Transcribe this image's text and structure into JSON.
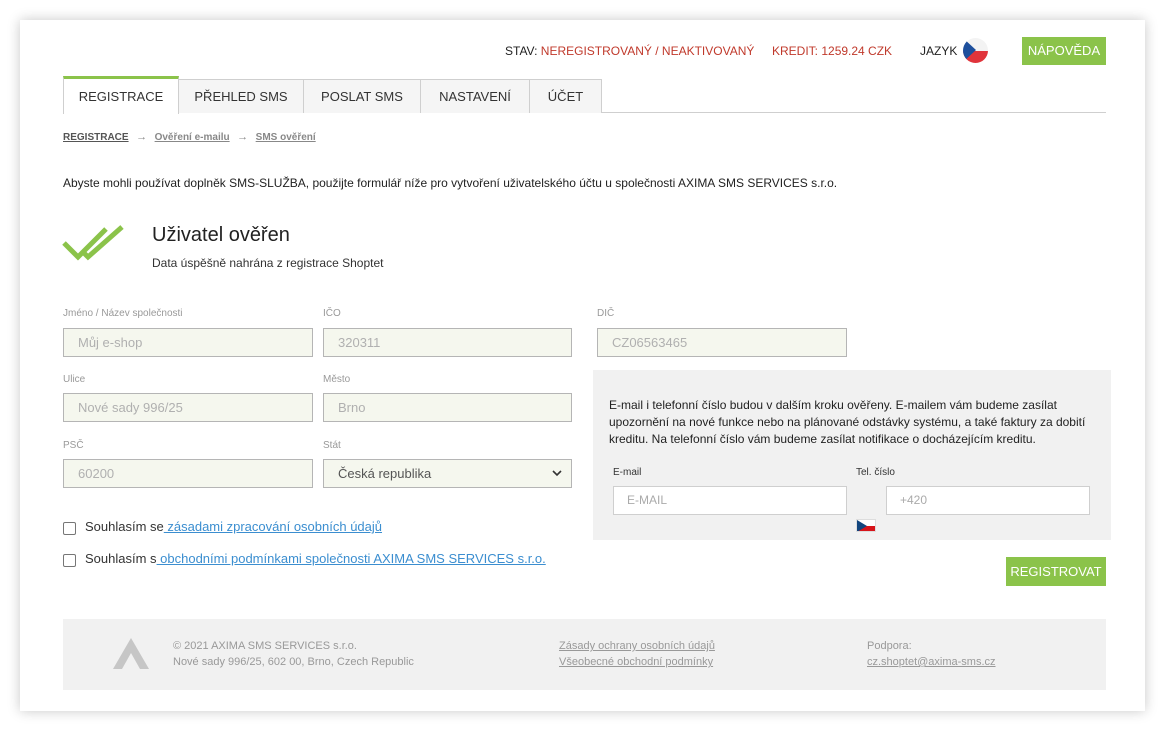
{
  "header": {
    "status_label": "STAV:",
    "status_value": "NEREGISTROVANÝ / NEAKTIVOVANÝ",
    "credit": "KREDIT: 1259.24 CZK",
    "language_label": "JAZYK",
    "help_button": "NÁPOVĚDA",
    "flag_icon": "czech-flag-icon"
  },
  "tabs": [
    {
      "label": "REGISTRACE",
      "active": true
    },
    {
      "label": "PŘEHLED SMS"
    },
    {
      "label": "POSLAT SMS"
    },
    {
      "label": "NASTAVENÍ"
    },
    {
      "label": "ÚČET"
    }
  ],
  "breadcrumb": [
    "REGISTRACE",
    "Ověření e-mailu",
    "SMS ověření"
  ],
  "intro_text": "Abyste mohli používat doplněk SMS-SLUŽBA, použijte formulář níže pro vytvoření uživatelského účtu u společnosti AXIMA SMS SERVICES s.r.o.",
  "verified": {
    "title": "Uživatel ověřen",
    "subtitle": "Data úspěšně nahrána z registrace Shoptet",
    "icon": "double-check-icon"
  },
  "form": {
    "name_label": "Jméno / Název společnosti",
    "name_value": "Můj e-shop",
    "ico_label": "IČO",
    "ico_value": "320311",
    "dic_label": "DIČ",
    "dic_value": "CZ06563465",
    "street_label": "Ulice",
    "street_value": "Nové sady 996/25",
    "city_label": "Město",
    "city_value": "Brno",
    "zip_label": "PSČ",
    "zip_value": "60200",
    "country_label": "Stát",
    "country_value": "Česká republika"
  },
  "info": {
    "text": "E-mail i telefonní číslo budou v dalším kroku ověřeny. E-mailem vám budeme zasílat upozornění na nové funkce nebo na plánované odstávky systému, a také faktury za dobití kreditu. Na telefonní číslo vám budeme zasílat notifikace o docházejícím kreditu.",
    "email_label": "E-mail",
    "email_placeholder": "E-MAIL",
    "phone_label": "Tel. číslo",
    "phone_placeholder": "+420"
  },
  "consents": [
    {
      "prefix": "Souhlasím se",
      "link": " zásadami zpracování osobních údajů"
    },
    {
      "prefix": "Souhlasím s",
      "link": " obchodními podmínkami společnosti AXIMA SMS SERVICES s.r.o."
    }
  ],
  "register_button": "REGISTROVAT",
  "footer": {
    "copyright": "© 2021 AXIMA SMS SERVICES s.r.o.",
    "address": "Nové sady 996/25, 602 00, Brno, Czech Republic",
    "privacy_link": "Zásady ochrany osobních údajů",
    "terms_link": "Všeobecné obchodní podmínky",
    "support_label": "Podpora:",
    "support_email": "cz.shoptet@axima-sms.cz"
  },
  "colors": {
    "accent": "#8bc34a",
    "status_red": "#c0392b",
    "link_blue": "#3b8ed0"
  }
}
